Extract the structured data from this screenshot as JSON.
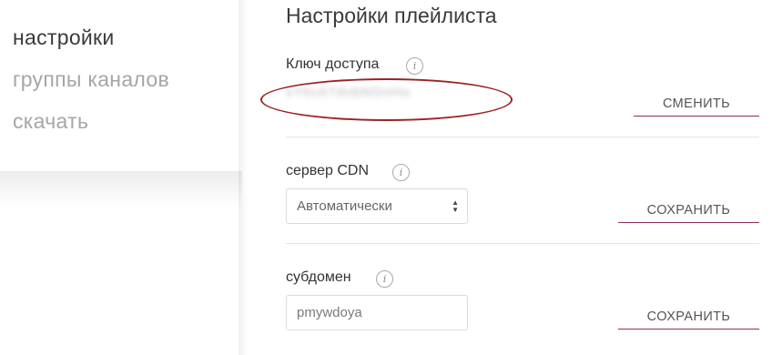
{
  "sidebar": {
    "items": [
      {
        "label": "настройки",
        "active": true
      },
      {
        "label": "группы каналов",
        "active": false
      },
      {
        "label": "скачать",
        "active": false
      }
    ]
  },
  "main": {
    "title": "Настройки плейлиста",
    "access_key": {
      "label": "Ключ доступа",
      "icon": "info-icon",
      "value_obscured": "xYbUt7dvbNGnHu",
      "button": "СМЕНИТЬ"
    },
    "cdn": {
      "label": "сервер CDN",
      "icon": "info-icon",
      "selected": "Автоматически",
      "button": "СОХРАНИТЬ"
    },
    "subdomain": {
      "label": "субдомен",
      "icon": "info-icon",
      "value": "pmywdoya",
      "button": "СОХРАНИТЬ"
    }
  },
  "colors": {
    "accent_underline": "#8c2e62",
    "annotation_ellipse": "#9b2226",
    "menu_active": "#3a3a3a",
    "menu_inactive": "#a6a6a6"
  }
}
